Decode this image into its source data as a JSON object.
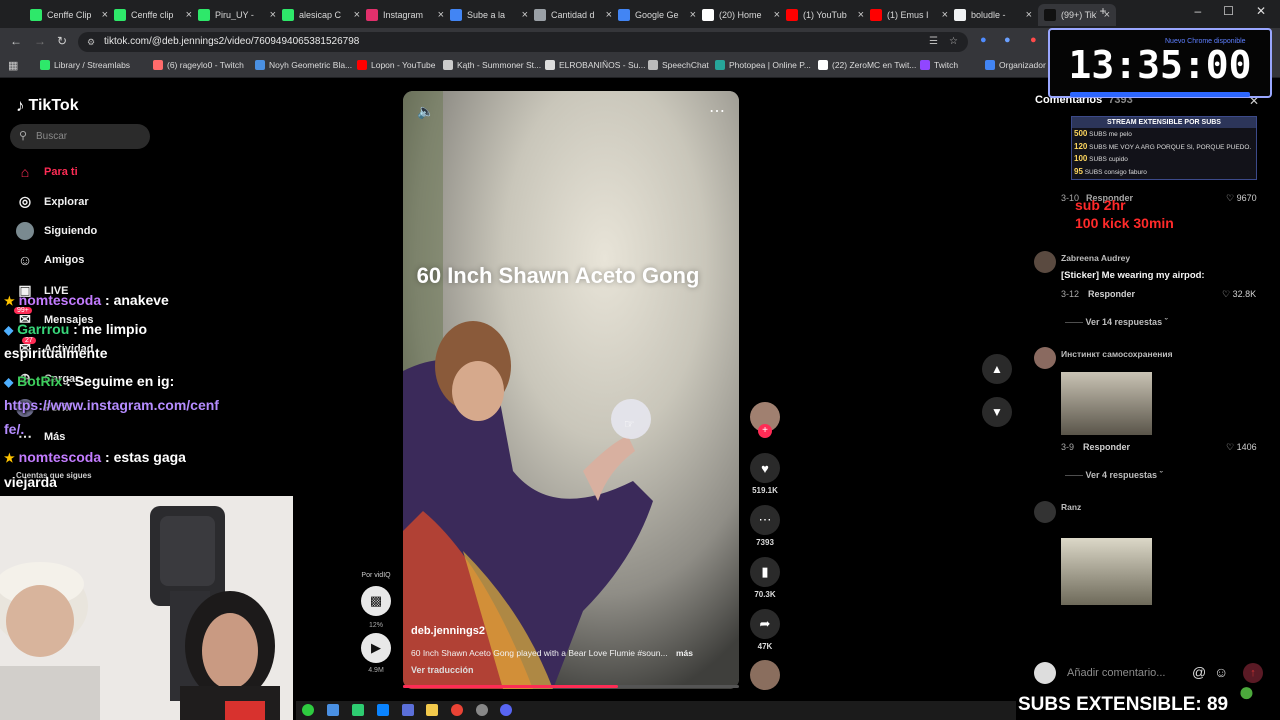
{
  "browser": {
    "tabs": [
      {
        "label": "Cenffe Clip",
        "color": "#2ee86a"
      },
      {
        "label": "Cenffe clip",
        "color": "#2ee86a"
      },
      {
        "label": "Piru_UY - ",
        "color": "#2ee86a"
      },
      {
        "label": "alesicap C",
        "color": "#2ee86a"
      },
      {
        "label": "Instagram",
        "color": "#e1306c"
      },
      {
        "label": "Sube a la ",
        "color": "#4285f4"
      },
      {
        "label": "Cantidad d",
        "color": "#9aa0a6"
      },
      {
        "label": "Google Ge",
        "color": "#4285f4"
      },
      {
        "label": "(20) Home",
        "color": "#ffffff"
      },
      {
        "label": "(1) YouTub",
        "color": "#ff0000"
      },
      {
        "label": "(1) Emus I",
        "color": "#ff0000"
      },
      {
        "label": "boludle - ",
        "color": "#f1f3f4"
      },
      {
        "label": "(99+) TikTo",
        "color": "#111111"
      }
    ],
    "url": "tiktok.com/@deb.jennings2/video/7609494065381526798",
    "bookmarks": [
      "Library / Streamlabs",
      "(6) rageylo0 - Twitch",
      "Noyh Geometric Bla...",
      "Lopon - YouTube",
      "Kąth - Summoner St...",
      "ELROBANIÑOS - Su...",
      "SpeechChat",
      "Photopea | Online P...",
      "(22) ZeroMC en Twit...",
      "Twitch",
      "Organizador De Z..."
    ]
  },
  "tiktok": {
    "logo": "TikTok",
    "search_placeholder": "Buscar",
    "nav": [
      {
        "label": "Para ti",
        "active": true
      },
      {
        "label": "Explorar"
      },
      {
        "label": "Siguiendo"
      },
      {
        "label": "Amigos"
      },
      {
        "label": "LIVE"
      },
      {
        "label": "Mensajes"
      },
      {
        "label": "Actividad"
      },
      {
        "label": "Cargar"
      },
      {
        "label": "Perfil"
      },
      {
        "label": "Más"
      }
    ],
    "following_label": "Cuentas que sigues",
    "badge_messages": "99+",
    "badge_activity": "27",
    "video": {
      "overlay_title": "60 Inch Shawn Aceto Gong",
      "author": "deb.jennings2",
      "caption": "60 Inch Shawn Aceto Gong played with a Bear Love Flumie #soun...",
      "more": "más",
      "translate": "Ver traducción",
      "progress": 0.64
    },
    "actions": {
      "likes": "519.1K",
      "comments": "7393",
      "saves": "70.3K",
      "shares": "47K"
    },
    "vidiq": {
      "label": "Por vidIQ",
      "pct": "12%",
      "views": "4.9M"
    },
    "comments": {
      "header": "Comentarios",
      "count": "7393",
      "items": [
        {
          "meta": "3-10",
          "reply": "Responder",
          "likes": "9670"
        },
        {
          "name": "Zabreena Audrey",
          "text": "[Sticker] Me wearing my airpod:",
          "meta": "3-12",
          "reply": "Responder",
          "likes": "32.8K",
          "replies": "Ver 14 respuestas"
        },
        {
          "name": "Инстинкт самосохранения",
          "meta": "3-9",
          "reply": "Responder",
          "likes": "1406",
          "replies": "Ver 4 respuestas"
        },
        {
          "name": "Ranz"
        }
      ],
      "input_placeholder": "Añadir comentario..."
    }
  },
  "stream": {
    "clock": "13:35:00",
    "chrome_update": "Nuevo Chrome disponible",
    "goals": {
      "title": "STREAM EXTENSIBLE POR SUBS",
      "rows": [
        {
          "n": "500",
          "unit": "SUBS",
          "text": "me pelo"
        },
        {
          "n": "120",
          "unit": "SUBS",
          "text": "ME VOY A ARG PORQUE SI, PORQUE PUEDO."
        },
        {
          "n": "100",
          "unit": "SUBS",
          "text": "cupido"
        },
        {
          "n": "95",
          "unit": "SUBS",
          "text": "consigo faburo"
        }
      ]
    },
    "red_lines": [
      "sub 2hr",
      "100 kick 30min"
    ],
    "subs_extensible": "SUBS EXTENSIBLE: 89",
    "chat": [
      {
        "user": "nomtescoda",
        "msg": " : anakeve"
      },
      {
        "user": "Garrrou",
        "msg": " : me limpio"
      },
      {
        "user": "",
        "msg": "espiritualmente"
      },
      {
        "user": "BotRix",
        "msg": " : Seguime en ig:"
      },
      {
        "user": "",
        "msg": "https://www.instagram.com/cenf"
      },
      {
        "user": "",
        "msg": "fe/."
      },
      {
        "user": "nomtescoda",
        "msg": " : estas gaga"
      },
      {
        "user": "",
        "msg": "viejarda"
      }
    ]
  }
}
